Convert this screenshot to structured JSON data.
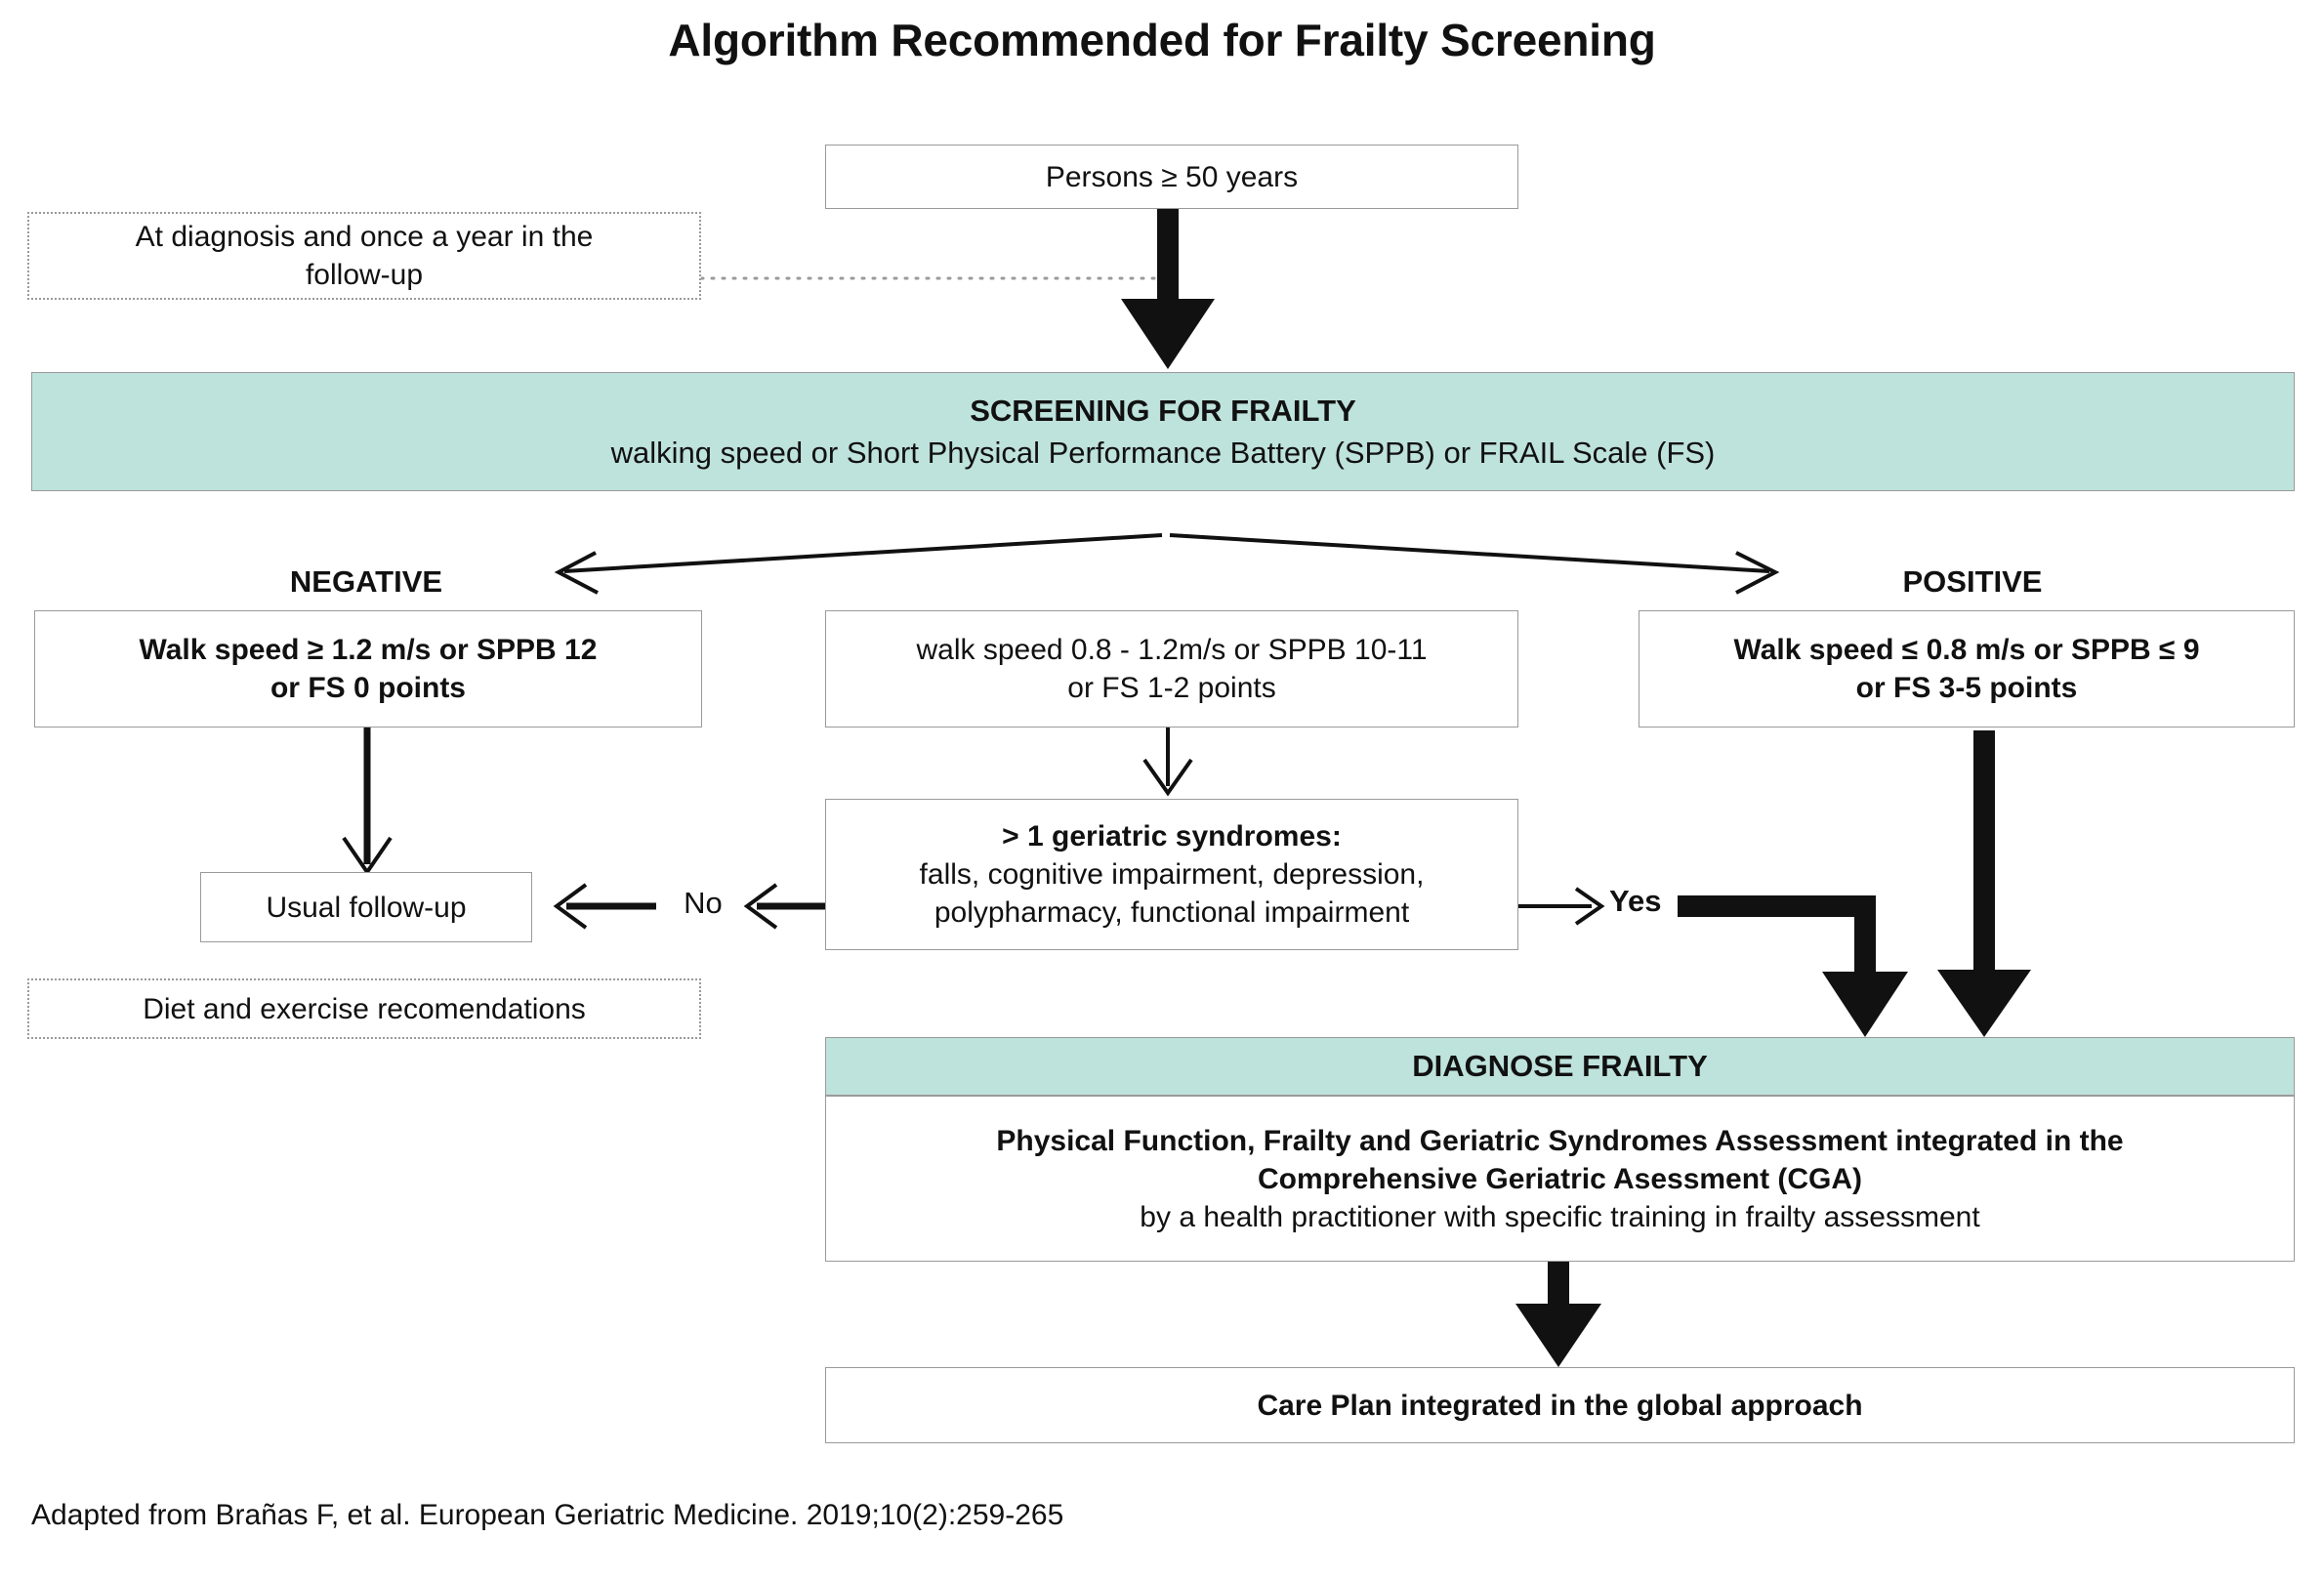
{
  "title": "Algorithm Recommended for Frailty Screening",
  "nodes": {
    "persons": "Persons ≥ 50 years",
    "timing_note": {
      "line1": "At diagnosis and once a year in the",
      "line2": "follow-up"
    },
    "screening": {
      "heading": "SCREENING FOR FRAILTY",
      "detail": "walking speed  or Short Physical Performance Battery (SPPB) or FRAIL Scale (FS)"
    },
    "negative_label": "NEGATIVE",
    "positive_label": "POSITIVE",
    "negative_criteria": {
      "line1": "Walk speed ≥ 1.2 m/s or SPPB 12",
      "line2": "or FS 0 points"
    },
    "prefrail_criteria": {
      "line1": "walk speed 0.8 - 1.2m/s or SPPB 10-11",
      "line2": "or FS 1-2 points"
    },
    "positive_criteria": {
      "line1": "Walk speed ≤ 0.8 m/s or SPPB ≤ 9",
      "line2": "or FS 3-5 points"
    },
    "syndromes": {
      "line1": "> 1 geriatric syndromes:",
      "line2": "falls, cognitive impairment, depression,",
      "line3": "polypharmacy, functional impairment"
    },
    "no_label": "No",
    "yes_label": "Yes",
    "usual_followup": "Usual follow-up",
    "diet_note": "Diet and exercise recomendations",
    "diagnose": {
      "heading": "DIAGNOSE FRAILTY",
      "line1": "Physical Function, Frailty and Geriatric Syndromes Assessment integrated in the",
      "line2": "Comprehensive Geriatric Asessment (CGA)",
      "line3": "by a health practitioner with specific training in frailty assessment"
    },
    "care_plan": "Care Plan integrated in the global approach"
  },
  "footer": "Adapted from Brañas F, et al. European Geriatric Medicine. 2019;10(2):259-265",
  "colors": {
    "banner_green": "#bee2dc",
    "border_gray": "#9a9a9a",
    "ink": "#111111"
  }
}
